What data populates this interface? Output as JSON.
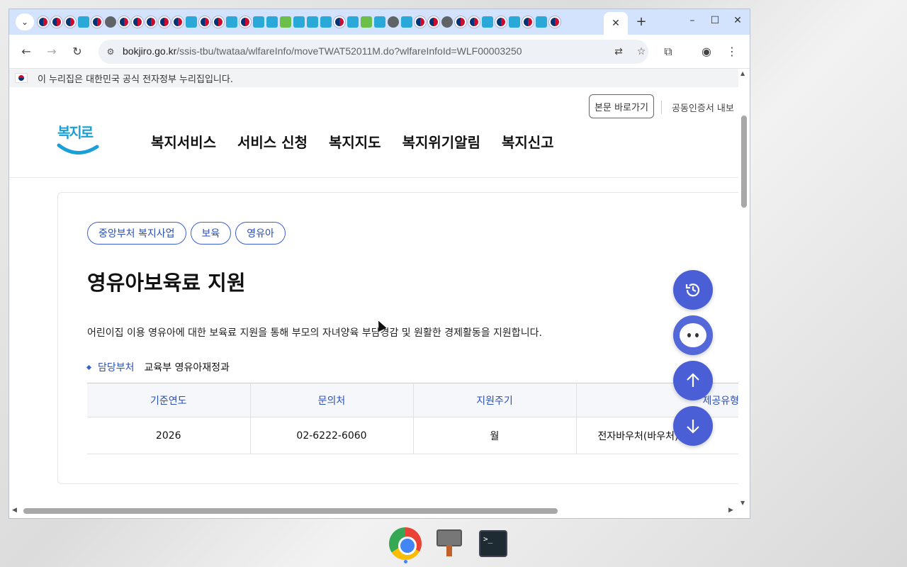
{
  "browser": {
    "active_tab_close": "✕",
    "new_tab": "+",
    "url_host": "bokjiro.go.kr",
    "url_path": "/ssis-tbu/twataa/wlfareInfo/moveTWAT52011M.do?wlfareInfoId=WLF00003250"
  },
  "gov_banner": {
    "text": "이 누리집은 대한민국 공식 전자정부 누리집입니다."
  },
  "header": {
    "skip_label": "본문 바로가기",
    "cert_label": "공동인증서 내보",
    "logo_text": "복지로",
    "nav": [
      "복지서비스",
      "서비스 신청",
      "복지지도",
      "복지위기알림",
      "복지신고"
    ]
  },
  "service": {
    "tags": [
      "중앙부처 복지사업",
      "보육",
      "영유아"
    ],
    "title": "영유아보육료 지원",
    "description": "어린이집 이용 영유아에 대한 보육료 지원을 통해 부모의 자녀양육 부담경감 및 원활한 경제활동을 지원합니다.",
    "dept_label": "담당부처",
    "dept_value": "교육부 영유아재정과",
    "table": {
      "headers": [
        "기준연도",
        "문의처",
        "지원주기",
        "제공유형"
      ],
      "row": [
        "2026",
        "02-6222-6060",
        "월",
        "전자바우처(바우처)"
      ]
    }
  },
  "icons": {
    "history": "history-icon",
    "chatbot": "chatbot-icon",
    "up": "arrow-up-icon",
    "down": "arrow-down-icon"
  }
}
